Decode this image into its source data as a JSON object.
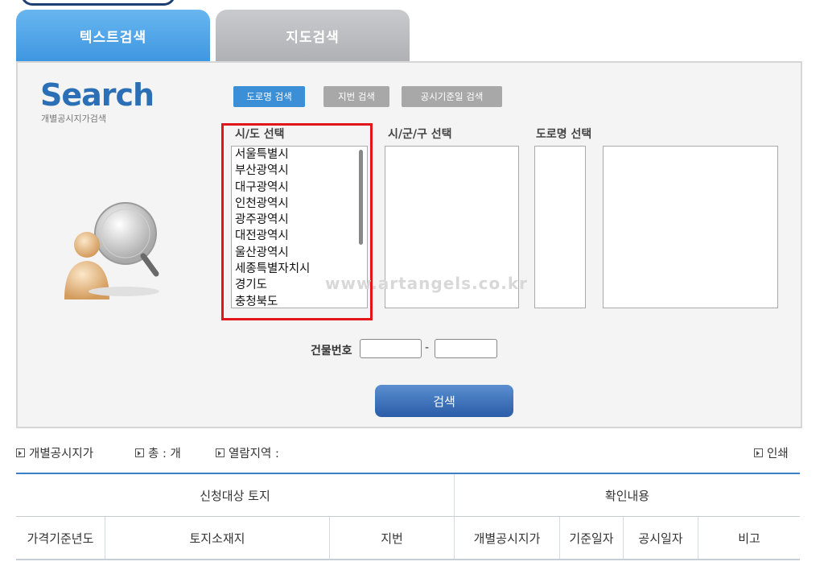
{
  "tabs": {
    "text_search": "텍스트검색",
    "map_search": "지도검색"
  },
  "logo": {
    "title": "Search",
    "subtitle": "개별공시지가검색"
  },
  "modes": {
    "road": "도로명 검색",
    "lot": "지번 검색",
    "date": "공시기준일 검색"
  },
  "columns": {
    "sido": "시/도 선택",
    "sigungu": "시/군/구 선택",
    "road": "도로명 선택"
  },
  "sido_options": [
    "서울특별시",
    "부산광역시",
    "대구광역시",
    "인천광역시",
    "광주광역시",
    "대전광역시",
    "울산광역시",
    "세종특별자치시",
    "경기도",
    "충청북도"
  ],
  "watermark": "www.artangels.co.kr",
  "building": {
    "label": "건물번호",
    "dash": "-",
    "value1": "",
    "value2": ""
  },
  "search_button": "검색",
  "info": {
    "price": "개별공시지가",
    "total": "총 : 개",
    "region": "열람지역 :",
    "print": "인쇄"
  },
  "table": {
    "group1": "신청대상 토지",
    "group2": "확인내용",
    "headers": [
      "가격기준년도",
      "토지소재지",
      "지번",
      "개별공시지가",
      "기준일자",
      "공시일자",
      "비고"
    ]
  },
  "colors": {
    "tab_active": "#4ea5e8",
    "tab_inactive": "#bfc0c3",
    "mode_active": "#3b8fd6",
    "highlight": "#e0161a",
    "button": "#2f64ae"
  }
}
